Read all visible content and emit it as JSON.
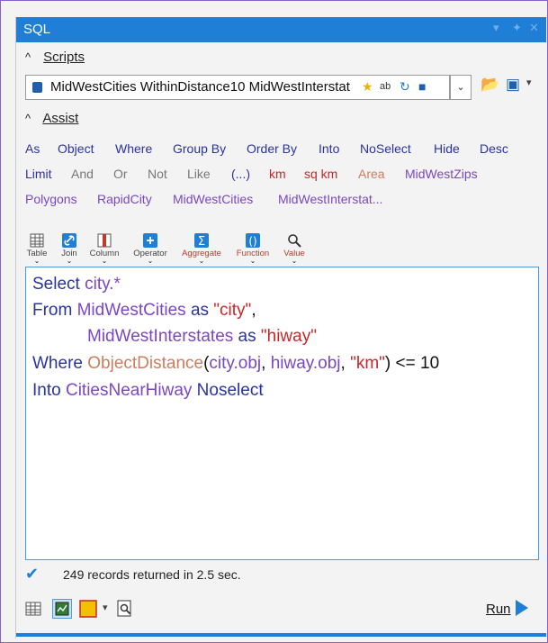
{
  "window": {
    "title": "SQL"
  },
  "sections": {
    "scripts_label": "Scripts",
    "assist_label": "Assist"
  },
  "scripts": {
    "selected": "MidWestCities WithinDistance10 MidWestInterstat"
  },
  "keywords": {
    "row1": [
      "As",
      "Object",
      "Where",
      "Group By",
      "Order By",
      "Into",
      "NoSelect",
      "Hide",
      "Desc"
    ],
    "row2": [
      "Limit",
      "And",
      "Or",
      "Not",
      "Like",
      "(...)",
      "km",
      "sq km",
      "Area",
      "MidWestZips"
    ],
    "row3": [
      "Polygons",
      "RapidCity",
      "MidWestCities",
      "MidWestInterstat..."
    ]
  },
  "tools": [
    "Table",
    "Join",
    "Column",
    "Operator",
    "Aggregate",
    "Function",
    "Value"
  ],
  "editor": {
    "l1_select": "Select",
    "l1_rest": " city.*",
    "l2_from": "From",
    "l2_tbl": " MidWestCities",
    "l2_as": " as",
    "l2_alias": " \"city\"",
    "l2_comma": ",",
    "l3_tbl": "MidWestInterstates",
    "l3_as": " as",
    "l3_alias": " \"hiway\"",
    "l4_where": "Where",
    "l4_fn": " ObjectDistance",
    "l4_p1": "(",
    "l4_a1": "city.obj",
    "l4_c1": ", ",
    "l4_a2": "hiway.obj",
    "l4_c2": ", ",
    "l4_s": "\"km\"",
    "l4_p2": ")",
    "l4_op": " <= 10",
    "l5_into": "Into",
    "l5_tbl": " CitiesNearHiway",
    "l5_ns": " Noselect"
  },
  "status": {
    "message": "249 records returned in 2.5 sec."
  },
  "run": {
    "label": "Run"
  },
  "colors": {
    "accent": "#1f7fd6",
    "keyword": "#2a33a0",
    "identifier": "#7b47c2",
    "string": "#c62828",
    "function": "#cf7d5e"
  }
}
